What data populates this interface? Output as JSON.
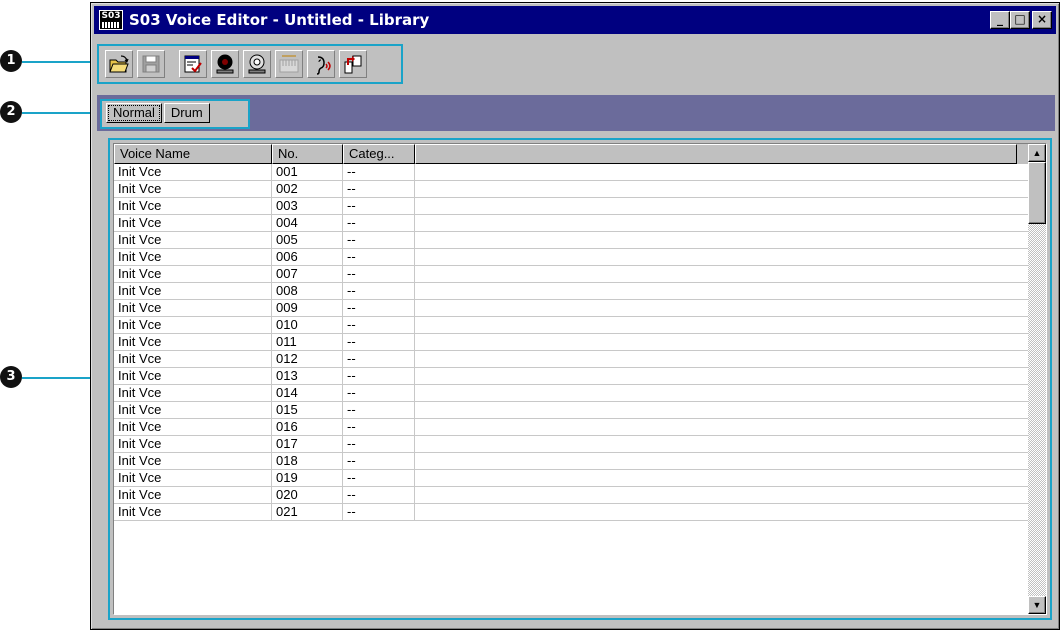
{
  "window": {
    "title": "S03 Voice Editor - Untitled - Library",
    "app_icon_text": "S03"
  },
  "window_buttons": {
    "minimize": "_",
    "maximize": "□",
    "close": "×"
  },
  "callouts": {
    "toolbar": "1",
    "tabs": "2",
    "list": "3"
  },
  "toolbar": {
    "buttons": [
      "open-folder-icon",
      "save-icon",
      "edit-check-icon",
      "receive-dump-icon",
      "transmit-dump-icon",
      "keyboard-icon",
      "audition-icon",
      "transfer-icon"
    ]
  },
  "tabs": [
    {
      "label": "Normal"
    },
    {
      "label": "Drum"
    }
  ],
  "list": {
    "columns": [
      "Voice Name",
      "No.",
      "Categ..."
    ],
    "rows": [
      {
        "name": "Init Vce",
        "no": "001",
        "cat": "--"
      },
      {
        "name": "Init Vce",
        "no": "002",
        "cat": "--"
      },
      {
        "name": "Init Vce",
        "no": "003",
        "cat": "--"
      },
      {
        "name": "Init Vce",
        "no": "004",
        "cat": "--"
      },
      {
        "name": "Init Vce",
        "no": "005",
        "cat": "--"
      },
      {
        "name": "Init Vce",
        "no": "006",
        "cat": "--"
      },
      {
        "name": "Init Vce",
        "no": "007",
        "cat": "--"
      },
      {
        "name": "Init Vce",
        "no": "008",
        "cat": "--"
      },
      {
        "name": "Init Vce",
        "no": "009",
        "cat": "--"
      },
      {
        "name": "Init Vce",
        "no": "010",
        "cat": "--"
      },
      {
        "name": "Init Vce",
        "no": "011",
        "cat": "--"
      },
      {
        "name": "Init Vce",
        "no": "012",
        "cat": "--"
      },
      {
        "name": "Init Vce",
        "no": "013",
        "cat": "--"
      },
      {
        "name": "Init Vce",
        "no": "014",
        "cat": "--"
      },
      {
        "name": "Init Vce",
        "no": "015",
        "cat": "--"
      },
      {
        "name": "Init Vce",
        "no": "016",
        "cat": "--"
      },
      {
        "name": "Init Vce",
        "no": "017",
        "cat": "--"
      },
      {
        "name": "Init Vce",
        "no": "018",
        "cat": "--"
      },
      {
        "name": "Init Vce",
        "no": "019",
        "cat": "--"
      },
      {
        "name": "Init Vce",
        "no": "020",
        "cat": "--"
      },
      {
        "name": "Init Vce",
        "no": "021",
        "cat": "--"
      }
    ]
  },
  "colors": {
    "title_bar": "#000080",
    "tab_area": "#6b6b9b",
    "callout_outline": "#1aa3c8"
  }
}
